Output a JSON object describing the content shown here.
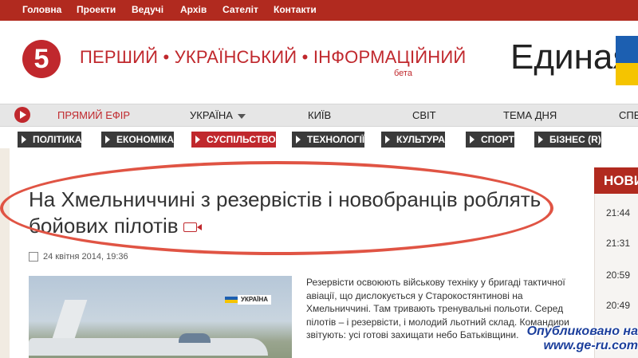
{
  "top_menu": [
    "Головна",
    "Проекти",
    "Ведучі",
    "Архів",
    "Сателіт",
    "Контакти"
  ],
  "logo": {
    "number": "5"
  },
  "brand": {
    "text": "ПЕРШИЙ • УКРАЇНСЬКИЙ • ІНФОРМАЦІЙНИЙ",
    "beta": "бета"
  },
  "ad": {
    "text": "Единая"
  },
  "nav": {
    "live": "ПРЯМИЙ ЕФІР",
    "items": [
      "УКРАЇНА",
      "КИЇВ",
      "СВІТ",
      "ТЕМА ДНЯ",
      "СПЕ"
    ]
  },
  "categories": [
    "ПОЛІТИКА",
    "ЕКОНОМІКА",
    "СУСПІЛЬСТВО",
    "ТЕХНОЛОГІЇ",
    "КУЛЬТУРА",
    "СПОРТ",
    "БІЗНЕС (R)"
  ],
  "article": {
    "title_line1": "На Хмельниччині з резервістів і новобранців роблять",
    "title_line2": "бойових пілотів",
    "date": "24 квітня 2014, 19:36",
    "photo_caption": "УКРАЇНА",
    "body": "Резервісти освоюють військову техніку у бригаді тактичної авіації, що дислокується у Старокостянтинові на Хмельниччині. Там тривають тренувальні польоти. Серед пілотів – і резервісти, і молодий льотний склад. Командири звітують: усі готові захищати небо Батьківщини."
  },
  "news": {
    "header": "НОВИ",
    "times": [
      "21:44",
      "21:31",
      "20:59",
      "20:49"
    ]
  },
  "watermark": {
    "line1": "Опубликовано на",
    "line2": "www.ge-ru.com"
  },
  "colors": {
    "brand_red": "#c0282d",
    "topbar": "#b12a1f",
    "category_bg": "#3a3a3a",
    "highlight": "#e05444"
  }
}
